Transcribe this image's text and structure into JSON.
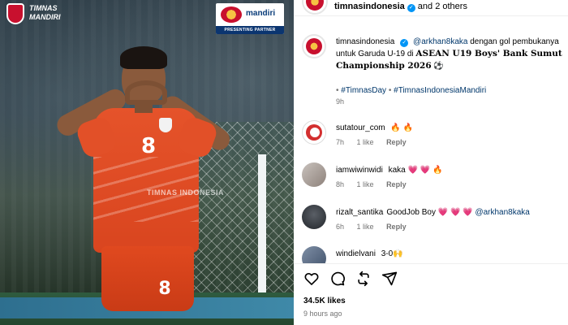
{
  "post_image": {
    "shirt_number": "8",
    "shorts_number": "8",
    "watermark": "TIMNAS INDONESIA",
    "team_logo_text": "TIMNAS MANDIRI",
    "partner": {
      "name": "mandiri",
      "tagline": "PRESENTING PARTNER"
    }
  },
  "header": {
    "username": "timnasindonesia",
    "suffix": "and 2 others"
  },
  "caption": {
    "username": "timnasindonesia",
    "mention": "@arkhan8kaka",
    "text_1": "dengan gol pembukanya",
    "text_2": "untuk Garuda U-19 di",
    "event": "ASEAN U19 Boys' Bank Sumut Championship 2026",
    "hashtag_1": "#TimnasDay",
    "separator_1": "•",
    "separator_2": "•",
    "hashtag_2": "#TimnasIndonesiaMandiri",
    "time": "9h"
  },
  "comments": [
    {
      "username": "sutatour_com",
      "text": "",
      "emojis": "🔥 🔥",
      "time": "7h",
      "likes": "1 like",
      "reply": "Reply"
    },
    {
      "username": "iamwiwinwidi",
      "text": "kaka",
      "emojis": "💗 💗 🔥",
      "time": "8h",
      "likes": "1 like",
      "reply": "Reply"
    },
    {
      "username": "rizalt_santika",
      "text": "GoodJob Boy",
      "emojis": "💗 💗 💗",
      "mention": "@arkhan8kaka",
      "time": "6h",
      "likes": "1 like",
      "reply": "Reply"
    },
    {
      "username": "windielvani",
      "text": "3-0",
      "emojis": "🙌"
    }
  ],
  "footer": {
    "likes": "34.5K likes",
    "time_ago": "9 hours ago"
  },
  "colors": {
    "link": "#00376b",
    "verified": "#0095f6",
    "muted": "#737373",
    "jersey": "#e5532a"
  },
  "icons": [
    "heart-icon",
    "comment-icon",
    "repost-icon",
    "share-icon"
  ]
}
